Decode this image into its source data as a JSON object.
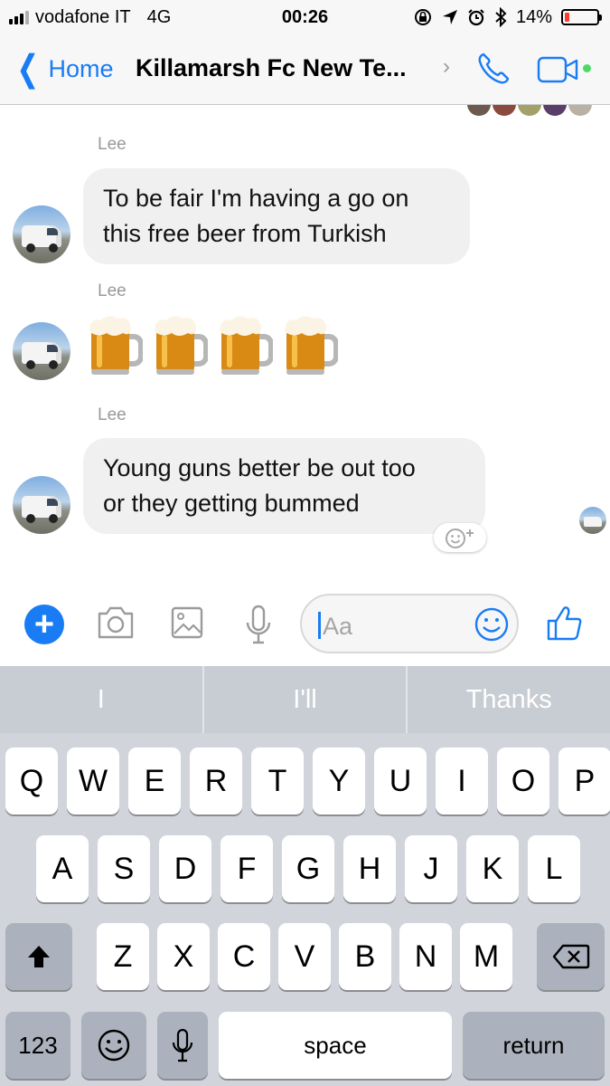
{
  "status_bar": {
    "carrier": "vodafone IT",
    "network": "4G",
    "time": "00:26",
    "battery_percent": "14%",
    "battery_level": 0.14,
    "icons": [
      "orientation-lock-icon",
      "location-icon",
      "alarm-icon",
      "bluetooth-icon"
    ]
  },
  "nav": {
    "back_label": "Home",
    "title": "Killamarsh Fc New Te...",
    "chevron": "›",
    "icons": [
      "phone-icon",
      "video-camera-icon"
    ]
  },
  "messages": [
    {
      "sender": "Lee",
      "text_lines": [
        "To be fair I'm having a go on",
        "this free beer from Turkish"
      ]
    },
    {
      "sender": "Lee",
      "emoji": [
        "🍺",
        "🍺",
        "🍺",
        "🍺"
      ]
    },
    {
      "sender": "Lee",
      "text_lines": [
        "Young guns better be out too",
        "or they getting bummed"
      ]
    }
  ],
  "composer": {
    "placeholder": "Aa",
    "icons": [
      "plus-icon",
      "camera-icon",
      "image-icon",
      "microphone-icon",
      "emoji-icon",
      "thumbs-up-icon"
    ]
  },
  "keyboard": {
    "predictions": [
      "I",
      "I'll",
      "Thanks"
    ],
    "row1": [
      "Q",
      "W",
      "E",
      "R",
      "T",
      "Y",
      "U",
      "I",
      "O",
      "P"
    ],
    "row2": [
      "A",
      "S",
      "D",
      "F",
      "G",
      "H",
      "J",
      "K",
      "L"
    ],
    "row3": [
      "Z",
      "X",
      "C",
      "V",
      "B",
      "N",
      "M"
    ],
    "numbers_label": "123",
    "space_label": "space",
    "return_label": "return"
  },
  "colors": {
    "accent": "#1a7cf4",
    "bubble": "#f1f0f0",
    "keyboard_bg": "#d1d5db"
  }
}
